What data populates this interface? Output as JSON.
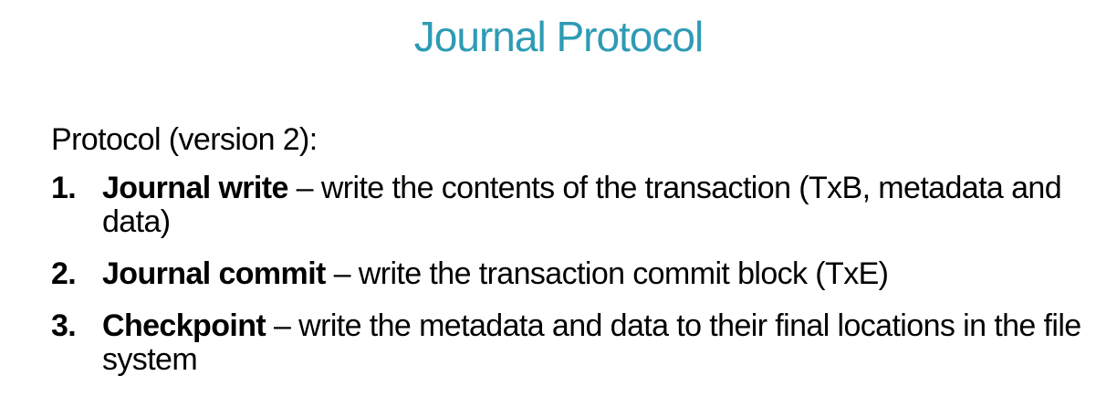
{
  "slide": {
    "title": "Journal Protocol",
    "intro": "Protocol (version 2):",
    "steps": [
      {
        "number": "1.",
        "term": "Journal write",
        "separator": " – ",
        "description": "write the contents of the transaction (TxB, metadata and data)"
      },
      {
        "number": "2.",
        "term": "Journal commit",
        "separator": " – ",
        "description": "write the transaction commit block (TxE)"
      },
      {
        "number": "3.",
        "term": "Checkpoint",
        "separator": " – ",
        "description": "write the metadata and data to their final locations in the file system"
      }
    ],
    "colors": {
      "title": "#2e9bb5",
      "text": "#000000",
      "background": "#ffffff"
    }
  }
}
